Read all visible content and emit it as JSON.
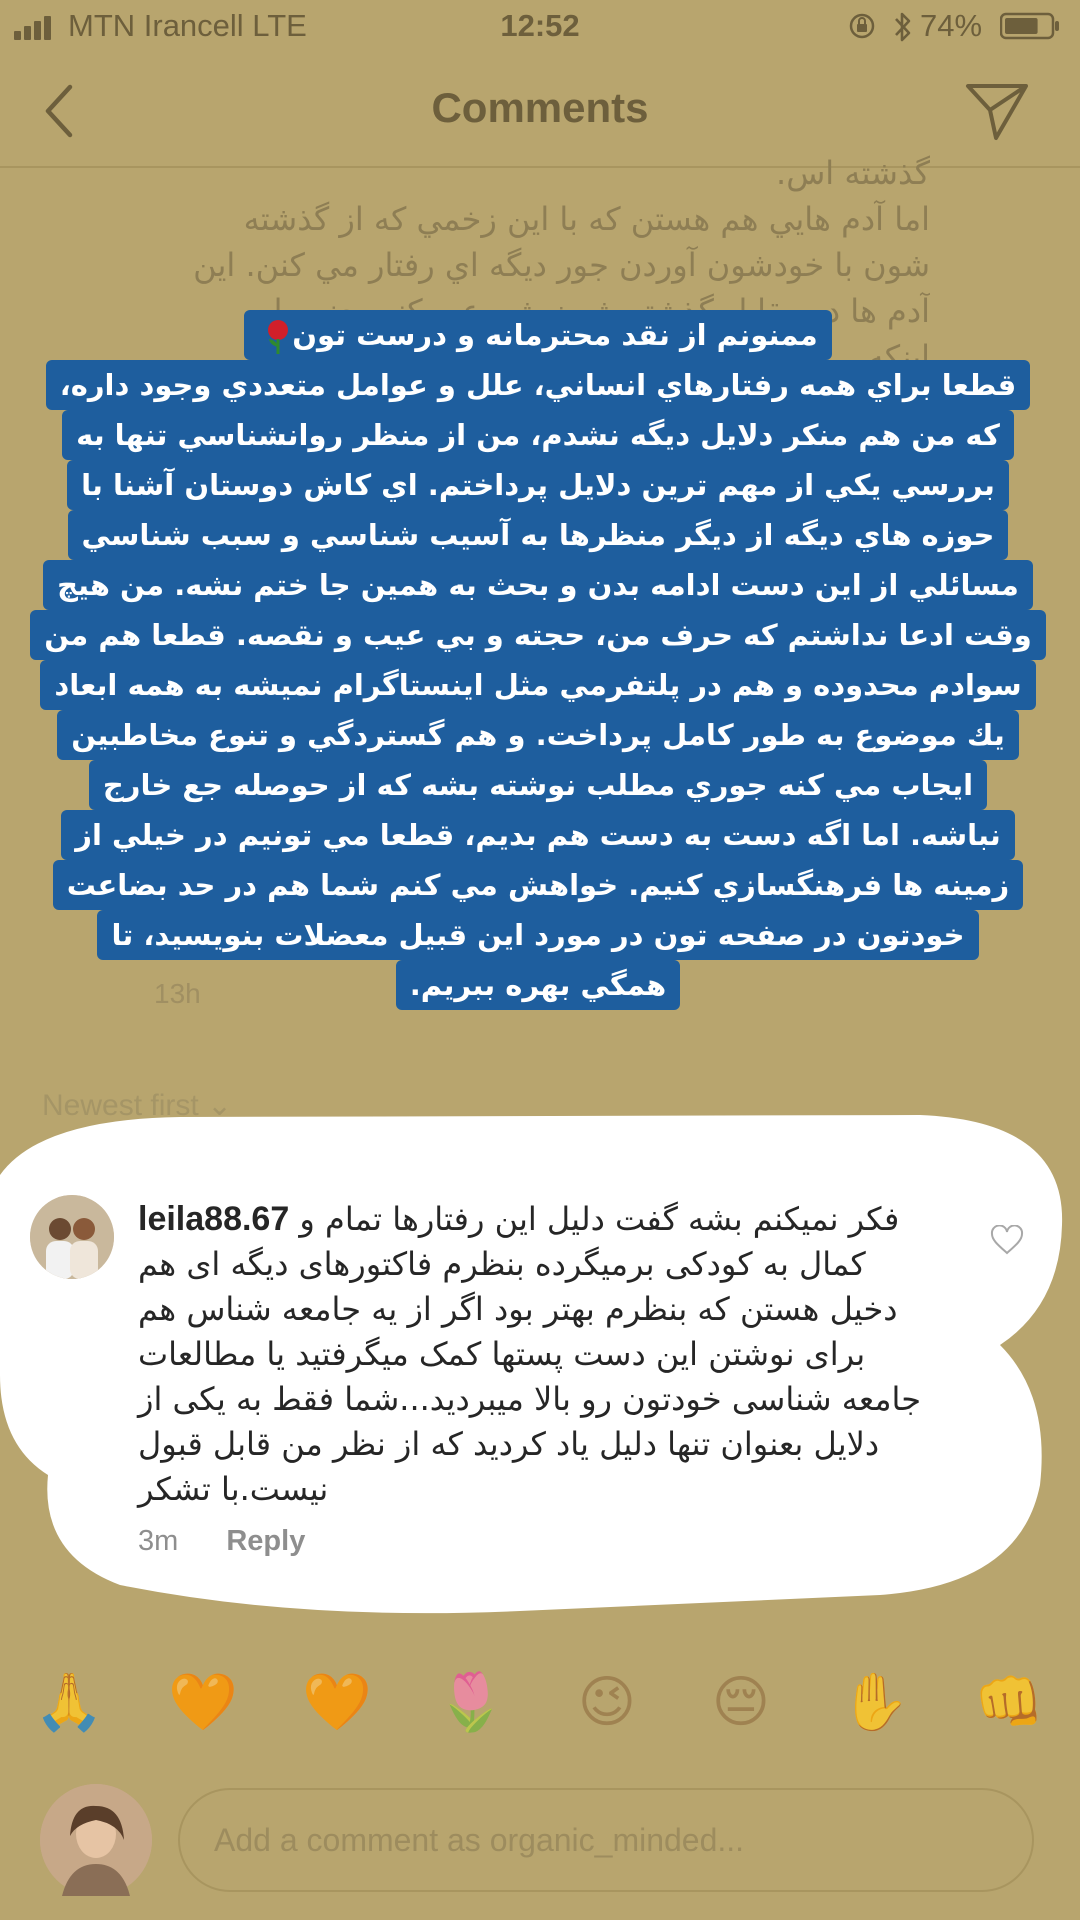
{
  "status": {
    "carrier": "MTN Irancell  LTE",
    "time": "12:52",
    "battery": "74%",
    "battery_level": 0.74
  },
  "nav": {
    "title": "Comments"
  },
  "background_comment": {
    "lines": [
      "گذشته اس.",
      "اما آدم هايي هم هستن كه با اين زخمي كه از گذشته",
      "شون با خودشون آوردن جور ديگه اي رفتار مي كنن. اين",
      "آدم ها در مقابل گذشته شون شروع ميكنن يعني با",
      "اينكه ..."
    ],
    "time": "13h",
    "sort_label": "Newest first"
  },
  "story": {
    "lines": [
      "ممنونم از نقد محترمانه و درست تون",
      "قطعا براي همه رفتارهاي انساني، علل و عوامل متعددي وجود داره،",
      "كه من هم منكر دلايل ديگه نشدم، من از منظر روانشناسي تنها به",
      "بررسي يكي از مهم ترين دلايل پرداختم. اي كاش دوستان آشنا با",
      "حوزه هاي ديگه از ديگر منظرها به آسيب شناسي و سبب شناسي",
      "مسائلي از اين دست ادامه بدن و بحث به همين جا ختم نشه. من هيچ",
      "وقت ادعا نداشتم كه حرف من، حجته و بي عيب و نقصه. قطعا هم من",
      "سوادم محدوده و هم در پلتفرمي مثل اينستاگرام نميشه به همه ابعاد",
      "يك موضوع به طور كامل پرداخت. و هم گستردگي و تنوع مخاطبين",
      "ايجاب مي كنه جوري مطلب نوشته بشه كه از حوصله جع خارج",
      "نباشه. اما اگه دست به دست هم بديم، قطعا مي تونيم در خيلي از",
      "زمينه ها فرهنگسازي كنيم. خواهش مي كنم شما هم در حد بضاعت",
      "خودتون در صفحه تون در مورد اين قبيل معضلات بنويسيد، تا",
      "همگي بهره ببريم."
    ]
  },
  "comment": {
    "username": "leila88.67",
    "text": "فکر نمیکنم بشه گفت دلیل این رفتارها تمام و کمال به کودکی برمیگرده بنظرم فاکتورهای دیگه ای هم دخیل هستن که بنظرم بهتر بود اگر از یه جامعه شناس هم برای نوشتن این دست پستها کمک میگرفتید یا مطالعات جامعه شناسی خودتون رو بالا میبردید...شما فقط به یکی از دلایل بعنوان تنها دلیل یاد کردید که از نظر من قابل قبول نیست.با تشکر",
    "time": "3m",
    "reply_label": "Reply"
  },
  "emoji_bar": {
    "items": [
      "🙏",
      "🧡",
      "🧡",
      "🌷",
      "😉",
      "😔",
      "✋",
      "👊"
    ]
  },
  "input": {
    "placeholder": "Add a comment as organic_minded..."
  }
}
